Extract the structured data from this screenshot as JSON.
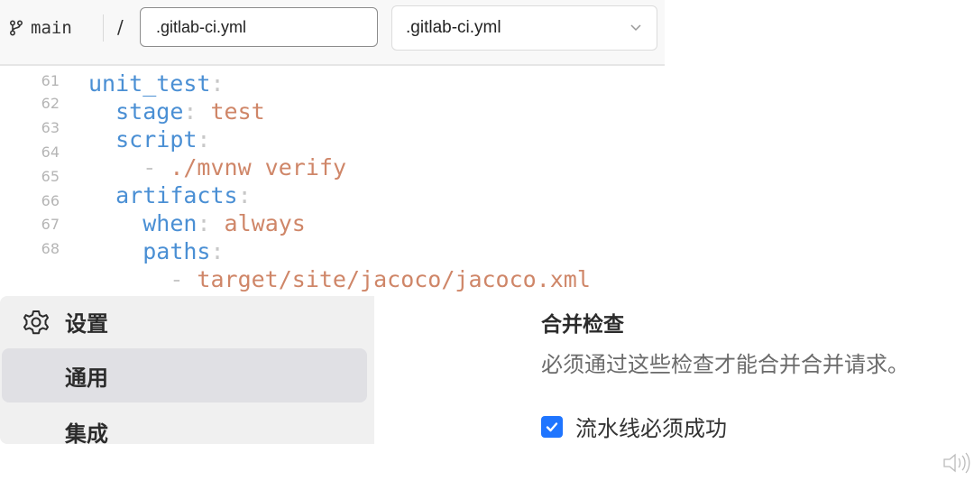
{
  "header": {
    "branch_icon": "git-branch-icon",
    "branch": "main",
    "path_separator": "/",
    "filename_value": ".gitlab-ci.yml",
    "template_select_value": ".gitlab-ci.yml",
    "template_select_icon": "chevron-down-icon"
  },
  "code": {
    "lines": [
      {
        "num": "61",
        "indent": "",
        "key": "unit_test",
        "colon": ":",
        "value": ""
      },
      {
        "num": "62",
        "indent": "  ",
        "key": "stage",
        "colon": ":",
        "value": " test"
      },
      {
        "num": "63",
        "indent": "  ",
        "key": "script",
        "colon": ":",
        "value": ""
      },
      {
        "num": "64",
        "indent": "    ",
        "dash": "- ",
        "value": "./mvnw verify"
      },
      {
        "num": "65",
        "indent": "  ",
        "key": "artifacts",
        "colon": ":",
        "value": ""
      },
      {
        "num": "66",
        "indent": "    ",
        "key": "when",
        "colon": ":",
        "value": " always"
      },
      {
        "num": "67",
        "indent": "    ",
        "key": "paths",
        "colon": ":",
        "value": ""
      },
      {
        "num": "68",
        "indent": "      ",
        "dash": "- ",
        "value": "target/site/jacoco/jacoco.xml"
      }
    ]
  },
  "sidebar": {
    "header_icon": "gear-icon",
    "header_label": "设置",
    "items": [
      {
        "label": "通用",
        "active": true
      },
      {
        "label": "集成",
        "active": false
      }
    ]
  },
  "merge_checks": {
    "title": "合并检查",
    "description": "必须通过这些检查才能合并合并请求。",
    "checkbox_label": "流水线必须成功",
    "checkbox_checked": true
  },
  "colors": {
    "yaml_key": "#4a8fd4",
    "yaml_value": "#cf8668",
    "checkbox_accent": "#1f75ff"
  }
}
